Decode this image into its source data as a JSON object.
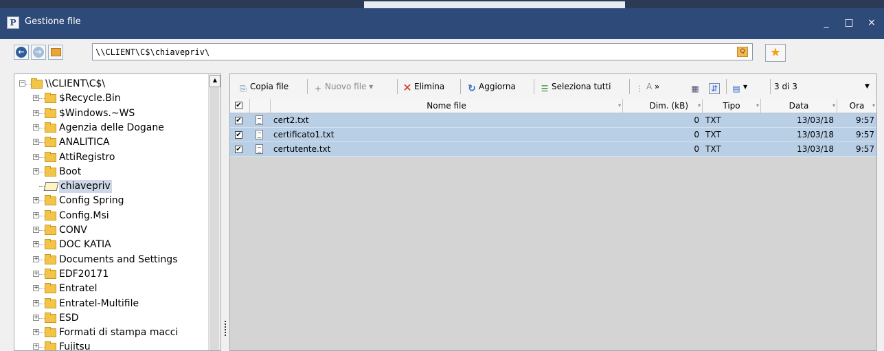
{
  "window": {
    "title": "Gestione file",
    "app_icon_letter": "P",
    "minimize": "_",
    "maximize": "□",
    "close": "×"
  },
  "address": {
    "path": "\\\\CLIENT\\C$\\chiavepriv\\"
  },
  "tree": {
    "root": "\\\\CLIENT\\C$\\",
    "items": [
      {
        "label": "$Recycle.Bin",
        "expander": "+"
      },
      {
        "label": "$Windows.~WS",
        "expander": "+"
      },
      {
        "label": "Agenzia delle Dogane",
        "expander": "+"
      },
      {
        "label": "ANALITICA",
        "expander": "+"
      },
      {
        "label": "AttiRegistro",
        "expander": "+"
      },
      {
        "label": "Boot",
        "expander": "+"
      },
      {
        "label": "chiavepriv",
        "expander": ""
      },
      {
        "label": "Config Spring",
        "expander": "+"
      },
      {
        "label": "Config.Msi",
        "expander": "+"
      },
      {
        "label": "CONV",
        "expander": "+"
      },
      {
        "label": "DOC KATIA",
        "expander": "+"
      },
      {
        "label": "Documents and Settings",
        "expander": "+"
      },
      {
        "label": "EDF20171",
        "expander": "+"
      },
      {
        "label": "Entratel",
        "expander": "+"
      },
      {
        "label": "Entratel-Multifile",
        "expander": "+"
      },
      {
        "label": "ESD",
        "expander": "+"
      },
      {
        "label": "Formati di stampa macci",
        "expander": "+"
      },
      {
        "label": "Fujitsu",
        "expander": "+"
      }
    ]
  },
  "file_toolbar": {
    "copy": "Copia file",
    "new": "Nuovo file",
    "delete": "Elimina",
    "refresh": "Aggiorna",
    "select_all": "Seleziona tutti",
    "more": "A",
    "chevron": "»",
    "count": "3 di 3"
  },
  "columns": {
    "name": "Nome file",
    "size": "Dim. (kB)",
    "type": "Tipo",
    "date": "Data",
    "time": "Ora"
  },
  "files": [
    {
      "name": "cert2.txt",
      "size": "0",
      "type": "TXT",
      "date": "13/03/18",
      "time": "9:57",
      "checked": "✔"
    },
    {
      "name": "certificato1.txt",
      "size": "0",
      "type": "TXT",
      "date": "13/03/18",
      "time": "9:57",
      "checked": "✔"
    },
    {
      "name": "certutente.txt",
      "size": "0",
      "type": "TXT",
      "date": "13/03/18",
      "time": "9:57",
      "checked": "✔"
    }
  ],
  "colors": {
    "titlebar": "#2d4a78",
    "selection": "#b9cfe6",
    "delete_icon": "#d22b1f",
    "refresh_icon": "#2d6bc8"
  }
}
